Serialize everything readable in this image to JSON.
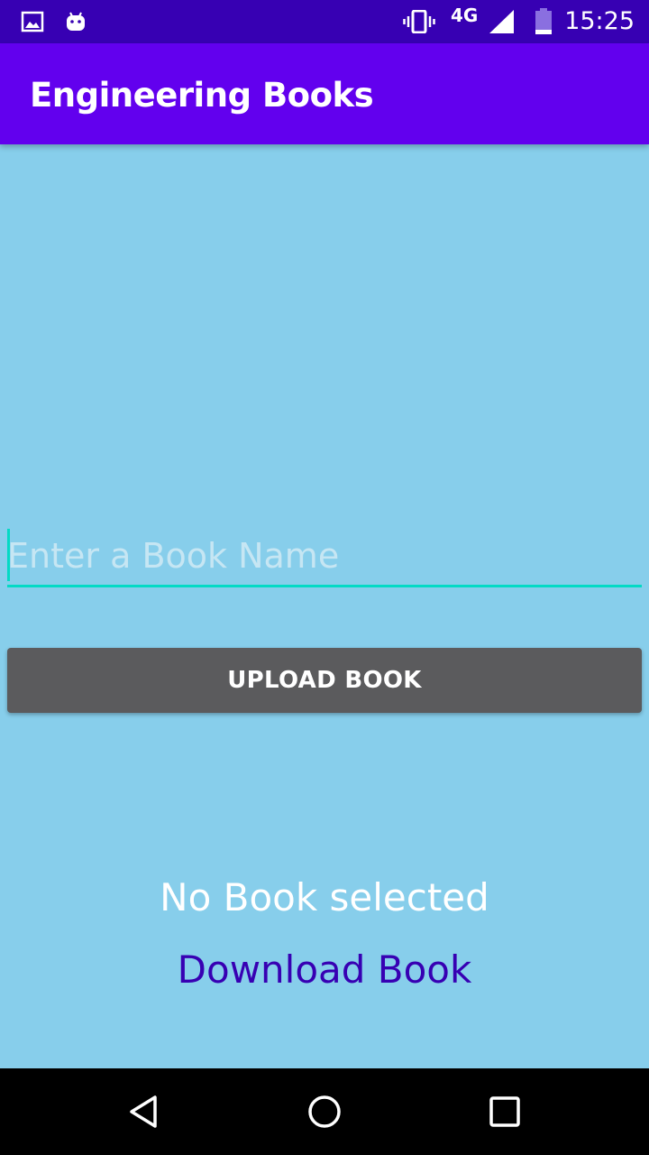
{
  "status_bar": {
    "network": "4G",
    "time": "15:25",
    "icons": [
      "gallery-icon",
      "android-icon",
      "vibrate-icon",
      "signal-icon",
      "battery-icon"
    ]
  },
  "app_bar": {
    "title": "Engineering Books"
  },
  "form": {
    "book_name_value": "",
    "book_name_placeholder": "Enter a Book Name",
    "upload_label": "UPLOAD BOOK"
  },
  "status": {
    "selected_text": "No Book selected",
    "download_label": "Download Book"
  },
  "nav_bar": {
    "icons": [
      "back-icon",
      "home-icon",
      "recents-icon"
    ]
  },
  "colors": {
    "status_bar": "#3700B3",
    "app_bar": "#6200EE",
    "background": "#87CEEB",
    "accent": "#03DAC5",
    "button": "#5B5B5D",
    "link": "#3700B3"
  }
}
